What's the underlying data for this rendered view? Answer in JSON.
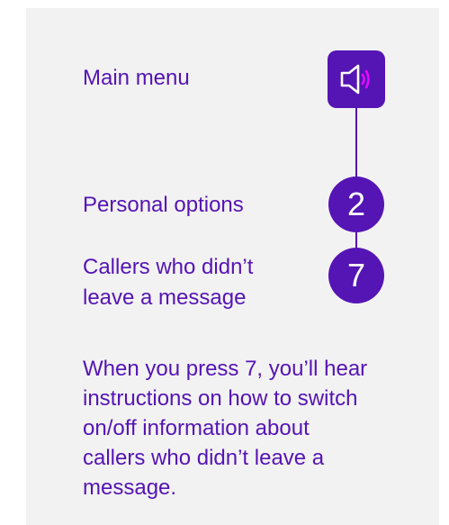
{
  "menu": {
    "main_menu": "Main menu",
    "personal_options": "Personal options",
    "callers_line1": "Callers who didn’t",
    "callers_line2": "leave a message"
  },
  "steps": {
    "icon": "speaker-sound-icon",
    "step_personal": "2",
    "step_callers": "7"
  },
  "description": {
    "line1": "When you press 7, you’ll hear",
    "line2": "instructions on how to switch",
    "line3": "on/off information about",
    "line4": "callers who didn’t leave a",
    "line5": "message."
  },
  "colors": {
    "accent": "#5514b4",
    "accent_light": "#e60aff",
    "panel_bg": "#f2f2f2",
    "badge_text": "#ffffff"
  }
}
